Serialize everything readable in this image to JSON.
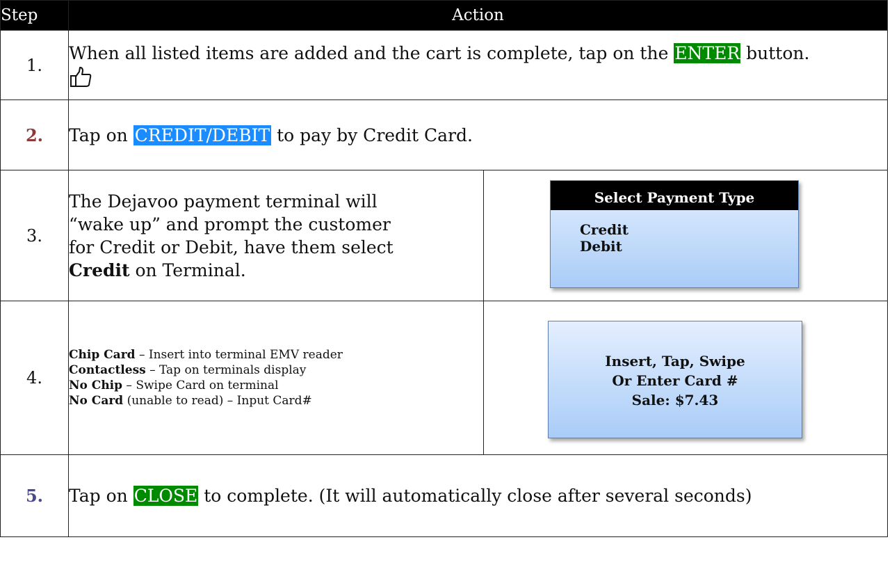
{
  "header": {
    "step": "Step",
    "action": "Action"
  },
  "steps": [
    {
      "number": "1.",
      "text_before": "When all listed items are added and the cart is complete,  tap on the ",
      "highlight": "ENTER",
      "text_after": " button.",
      "icon": "thumbs-up-icon",
      "highlight_color": "#008a00"
    },
    {
      "number": "2.",
      "text_before": "Tap on ",
      "highlight": "CREDIT/DEBIT",
      "text_after": "  to pay by Credit Card.",
      "highlight_color": "#1a8cff"
    },
    {
      "number": "3.",
      "line1": "The Dejavoo payment terminal will",
      "line2": "“wake up” and prompt  the customer",
      "line3": "for Credit or Debit, have them select",
      "bold": "Credit",
      "line4_after": " on Terminal.",
      "screen": {
        "title": "Select Payment Type",
        "options": [
          "Credit",
          "Debit"
        ]
      }
    },
    {
      "number": "4.",
      "items": [
        {
          "bold": "Chip Card",
          "text": " – Insert into terminal EMV reader"
        },
        {
          "bold": "Contactless",
          "text": " – Tap on terminals display"
        },
        {
          "bold": "No Chip",
          "text": " – Swipe Card on terminal"
        },
        {
          "bold": "No Card",
          "text": " (unable to read) – Input Card#"
        }
      ],
      "screen": {
        "lines": [
          "Insert, Tap, Swipe",
          "Or Enter Card #",
          "Sale: $7.43"
        ]
      }
    },
    {
      "number": "5.",
      "text_before": "Tap on ",
      "highlight": "CLOSE",
      "text_after": " to complete.  (It will automatically close after several seconds)",
      "highlight_color": "#008a00"
    }
  ]
}
